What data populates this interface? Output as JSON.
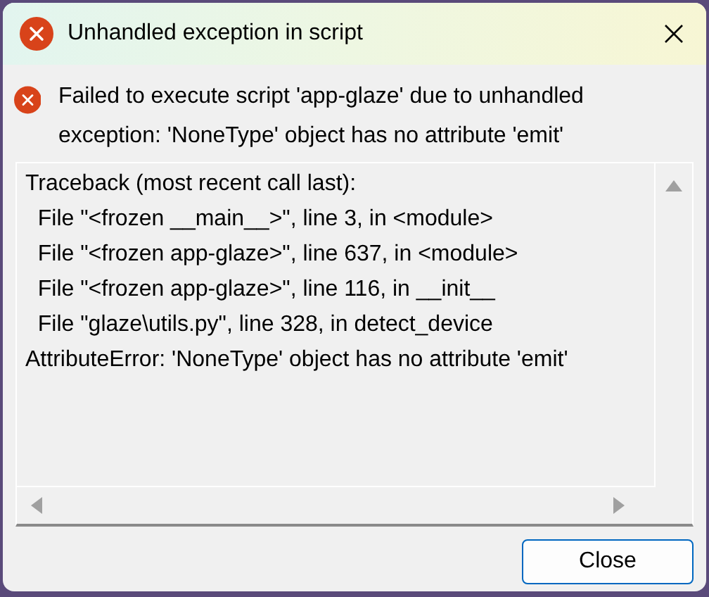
{
  "window": {
    "title": "Unhandled exception in script"
  },
  "message": "Failed to execute script 'app-glaze' due to unhandled exception: 'NoneType' object has no attribute 'emit'",
  "traceback": [
    "Traceback (most recent call last):",
    "  File \"<frozen __main__>\", line 3, in <module>",
    "  File \"<frozen app-glaze>\", line 637, in <module>",
    "  File \"<frozen app-glaze>\", line 116, in __init__",
    "  File \"glaze\\utils.py\", line 328, in detect_device",
    "AttributeError: 'NoneType' object has no attribute 'emit'"
  ],
  "buttons": [
    "Close"
  ]
}
